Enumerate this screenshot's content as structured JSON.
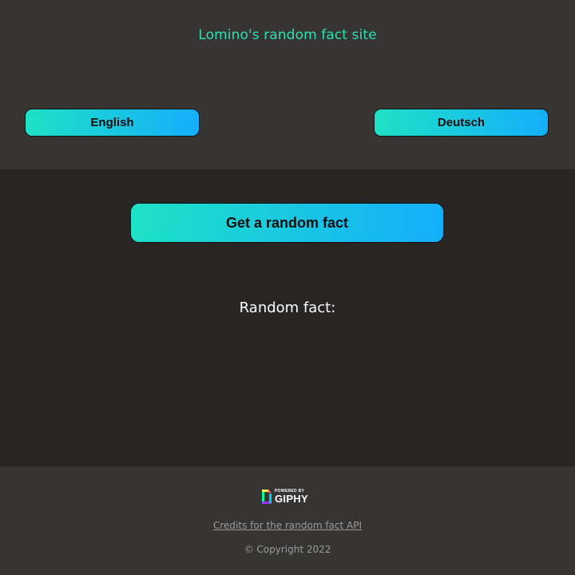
{
  "header": {
    "title": "Lomino's random fact site",
    "languages": [
      {
        "label": "English"
      },
      {
        "label": "Deutsch"
      }
    ]
  },
  "main": {
    "fact_button_label": "Get a random fact",
    "fact_label": "Random fact:",
    "fact_text": ""
  },
  "footer": {
    "giphy": {
      "powered_by": "POWERED BY",
      "brand": "GIPHY",
      "icon": "giphy-logo-icon"
    },
    "credits_link": "Credits for the random fact API",
    "copyright": "© Copyright 2022"
  },
  "colors": {
    "accent": "#2de0b1",
    "gradient_start": "#1ee2c5",
    "gradient_end": "#14aefc",
    "header_bg": "#363534",
    "main_bg": "#282525"
  }
}
